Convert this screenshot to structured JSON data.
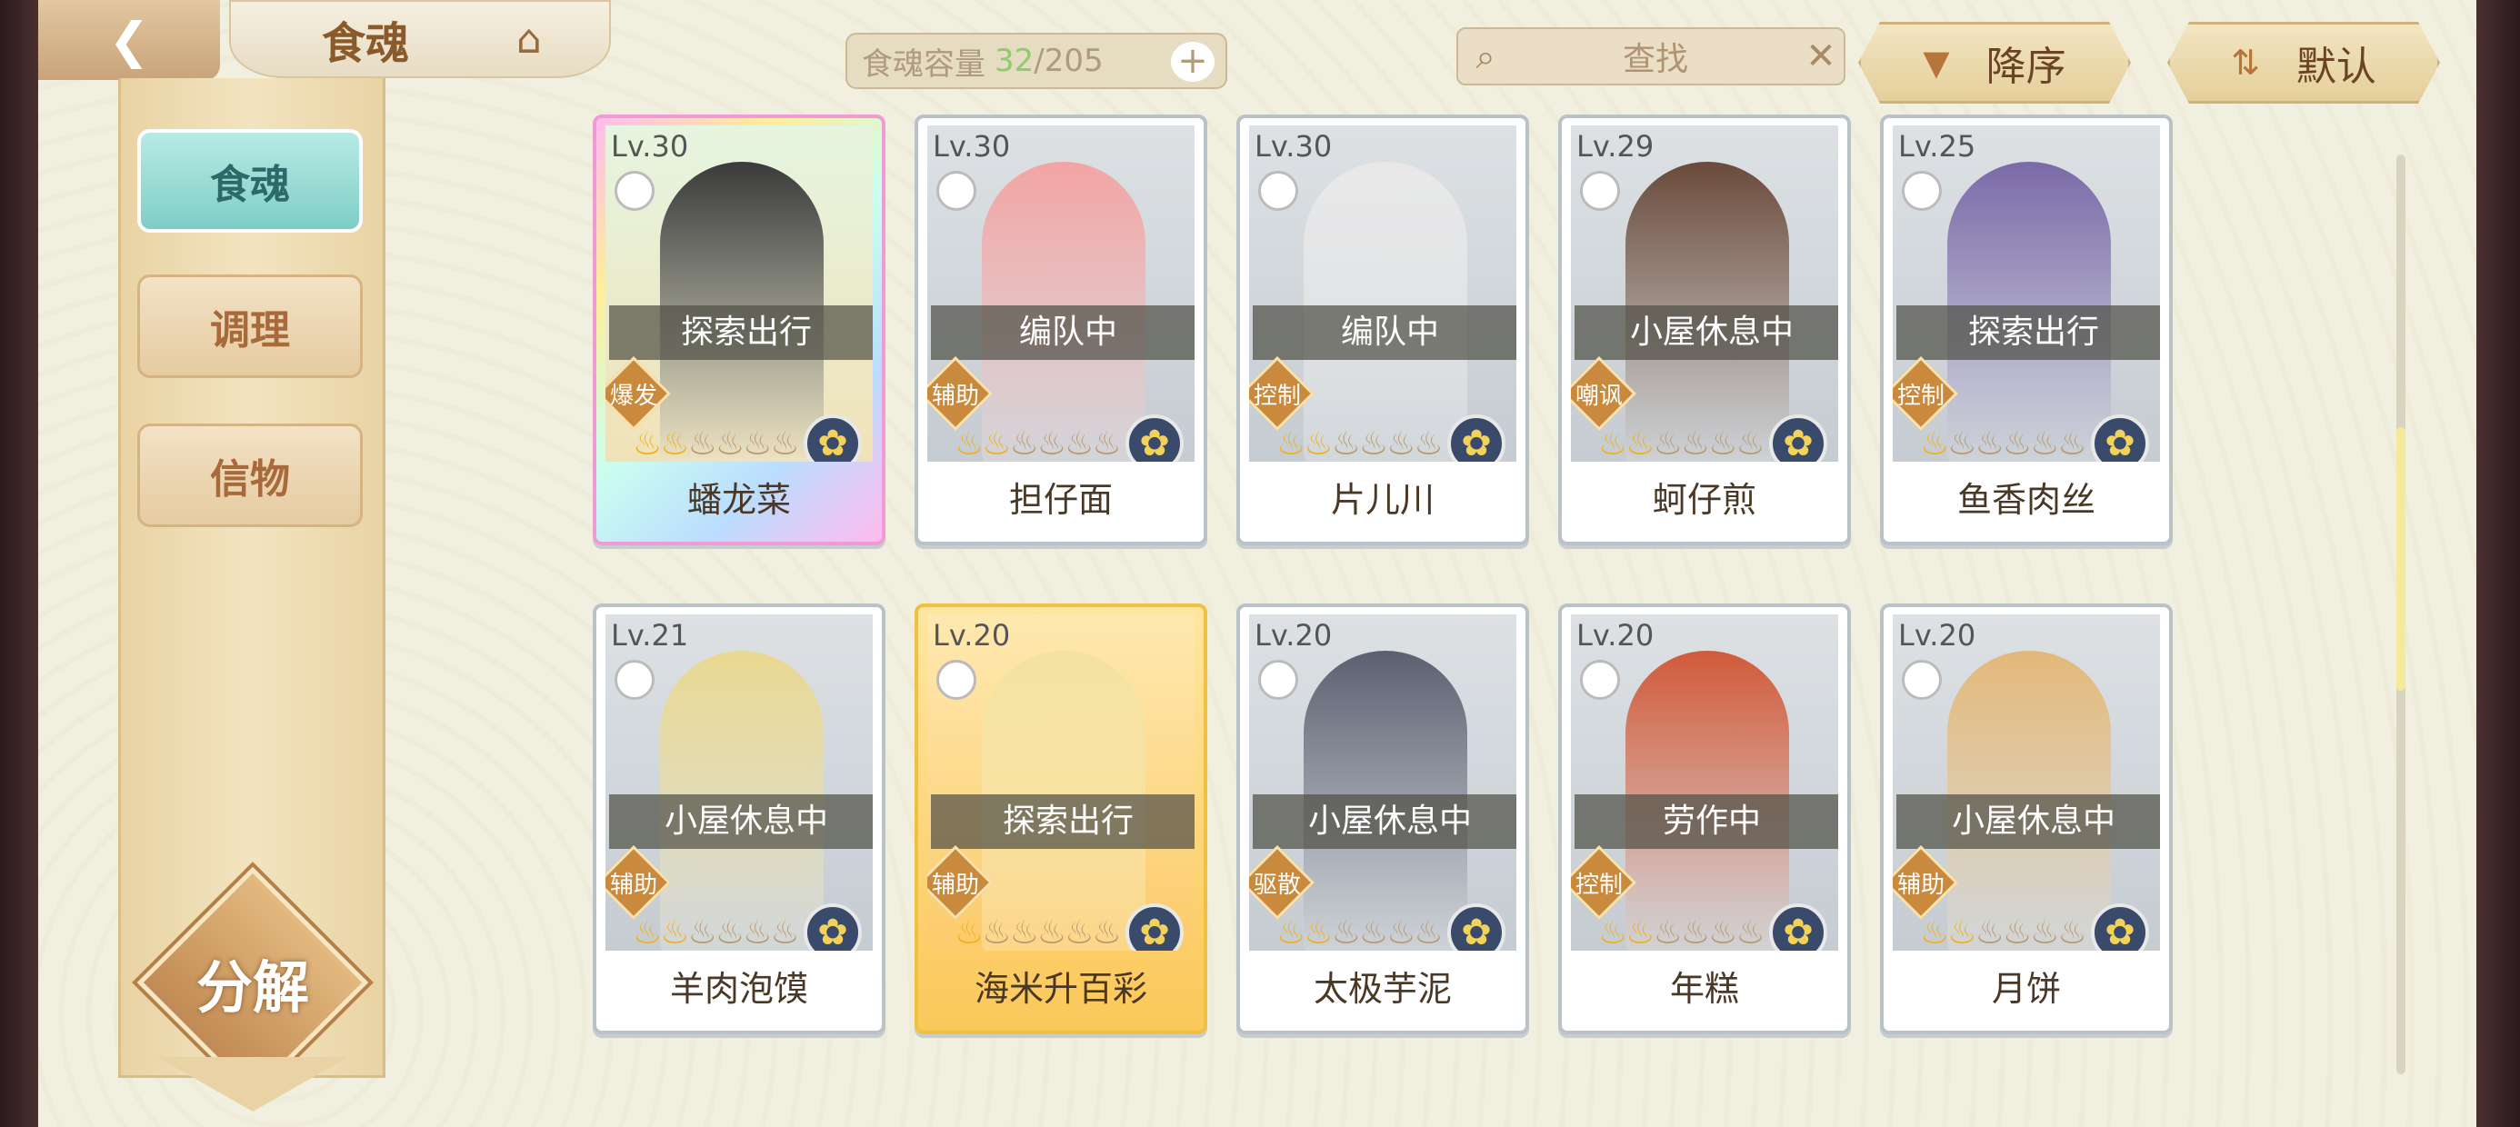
{
  "header": {
    "title": "食魂",
    "capacity_label": "食魂容量",
    "capacity_current": "32",
    "capacity_total": "/205",
    "search_placeholder": "查找",
    "sort_order": "降序",
    "sort_mode": "默认"
  },
  "sidebar": {
    "items": [
      {
        "label": "食魂"
      },
      {
        "label": "调理"
      },
      {
        "label": "信物"
      }
    ],
    "decompose_label": "分解"
  },
  "colors": {
    "accent": "#7ecec6",
    "capacity_current": "#8ccc6a"
  },
  "cards": [
    {
      "level": "Lv.30",
      "status": "探索出行",
      "role": "爆发",
      "name": "蟠龙菜",
      "stars_on": 2,
      "stars_total": 6,
      "frame": "rainbow",
      "hue": "#3a3a3a"
    },
    {
      "level": "Lv.30",
      "status": "编队中",
      "role": "辅助",
      "name": "担仔面",
      "stars_on": 2,
      "stars_total": 6,
      "frame": "silver",
      "hue": "#f2a4a4"
    },
    {
      "level": "Lv.30",
      "status": "编队中",
      "role": "控制",
      "name": "片儿川",
      "stars_on": 2,
      "stars_total": 6,
      "frame": "silver",
      "hue": "#e8e8e8"
    },
    {
      "level": "Lv.29",
      "status": "小屋休息中",
      "role": "嘲讽",
      "name": "蚵仔煎",
      "stars_on": 2,
      "stars_total": 6,
      "frame": "silver",
      "hue": "#6a4a3a"
    },
    {
      "level": "Lv.25",
      "status": "探索出行",
      "role": "控制",
      "name": "鱼香肉丝",
      "stars_on": 1,
      "stars_total": 6,
      "frame": "silver",
      "hue": "#7a6aa8"
    },
    {
      "level": "Lv.21",
      "status": "小屋休息中",
      "role": "辅助",
      "name": "羊肉泡馍",
      "stars_on": 2,
      "stars_total": 6,
      "frame": "silver",
      "hue": "#e9d890"
    },
    {
      "level": "Lv.20",
      "status": "探索出行",
      "role": "辅助",
      "name": "海米升百彩",
      "stars_on": 1,
      "stars_total": 6,
      "frame": "gold",
      "hue": "#f3e2a0"
    },
    {
      "level": "Lv.20",
      "status": "小屋休息中",
      "role": "驱散",
      "name": "太极芋泥",
      "stars_on": 2,
      "stars_total": 6,
      "frame": "silver",
      "hue": "#5a6070"
    },
    {
      "level": "Lv.20",
      "status": "劳作中",
      "role": "控制",
      "name": "年糕",
      "stars_on": 2,
      "stars_total": 6,
      "frame": "silver",
      "hue": "#d05a3a"
    },
    {
      "level": "Lv.20",
      "status": "小屋休息中",
      "role": "辅助",
      "name": "月饼",
      "stars_on": 2,
      "stars_total": 6,
      "frame": "silver",
      "hue": "#e2b878"
    }
  ]
}
